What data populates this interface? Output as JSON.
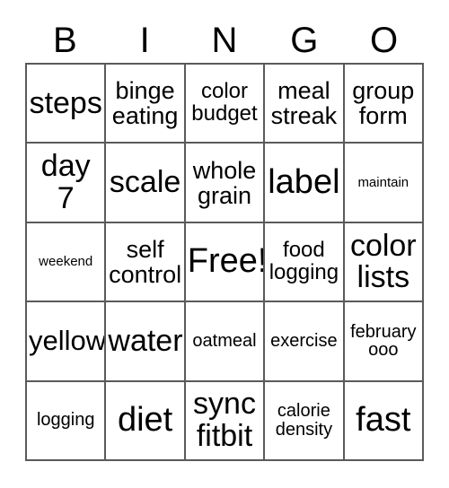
{
  "card": {
    "title": "BINGO",
    "header_letters": [
      "B",
      "I",
      "N",
      "G",
      "O"
    ],
    "border_color": "#5a5a5a",
    "text_color": "#000000",
    "background_color": "#ffffff",
    "rows": [
      [
        {
          "text": "steps",
          "size": "fs-2xl"
        },
        {
          "text": "binge\neating",
          "size": "fs-lg"
        },
        {
          "text": "color\nbudget",
          "size": "fs-md"
        },
        {
          "text": "meal\nstreak",
          "size": "fs-lg"
        },
        {
          "text": "group\nform",
          "size": "fs-lg"
        }
      ],
      [
        {
          "text": "day\n7",
          "size": "fs-2xl"
        },
        {
          "text": "scale",
          "size": "fs-2xl"
        },
        {
          "text": "whole\ngrain",
          "size": "fs-lg"
        },
        {
          "text": "label",
          "size": "fs-3xl"
        },
        {
          "text": "maintain",
          "size": "fs-xs"
        }
      ],
      [
        {
          "text": "weekend",
          "size": "fs-xs"
        },
        {
          "text": "self\ncontrol",
          "size": "fs-lg"
        },
        {
          "text": "Free!",
          "size": "fs-3xl"
        },
        {
          "text": "food\nlogging",
          "size": "fs-md"
        },
        {
          "text": "color\nlists",
          "size": "fs-2xl"
        }
      ],
      [
        {
          "text": "yellow",
          "size": "fs-xl"
        },
        {
          "text": "water",
          "size": "fs-2xl"
        },
        {
          "text": "oatmeal",
          "size": "fs-sm"
        },
        {
          "text": "exercise",
          "size": "fs-sm"
        },
        {
          "text": "february\nooo",
          "size": "fs-sm"
        }
      ],
      [
        {
          "text": "logging",
          "size": "fs-sm"
        },
        {
          "text": "diet",
          "size": "fs-3xl"
        },
        {
          "text": "sync\nfitbit",
          "size": "fs-2xl"
        },
        {
          "text": "calorie\ndensity",
          "size": "fs-sm"
        },
        {
          "text": "fast",
          "size": "fs-3xl"
        }
      ]
    ]
  }
}
